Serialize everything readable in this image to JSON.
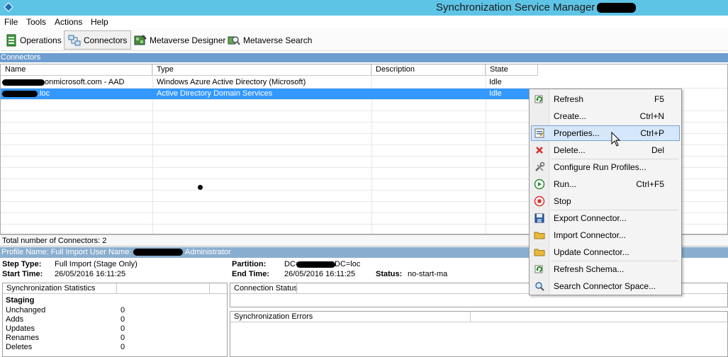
{
  "window": {
    "title": "Synchronization Service Manager on"
  },
  "menu": [
    "File",
    "Tools",
    "Actions",
    "Help"
  ],
  "toolbar": [
    {
      "label": "Operations",
      "icon": "operations-icon"
    },
    {
      "label": "Connectors",
      "icon": "connectors-icon",
      "active": true
    },
    {
      "label": "Metaverse Designer",
      "icon": "metaverse-designer-icon"
    },
    {
      "label": "Metaverse Search",
      "icon": "metaverse-search-icon"
    }
  ],
  "connectors": {
    "section_title": "Connectors",
    "columns": [
      "Name",
      "Type",
      "Description",
      "State"
    ],
    "rows": [
      {
        "name": "onmicrosoft.com - AAD",
        "type": "Windows Azure Active Directory (Microsoft)",
        "description": "",
        "state": "Idle"
      },
      {
        "name": ".loc",
        "type": "Active Directory Domain Services",
        "description": "",
        "state": "Idle",
        "selected": true
      }
    ],
    "total": "Total number of Connectors: 2"
  },
  "profile": {
    "bar_prefix": "Profile Name: Full Import  User Name:",
    "bar_suffix": "Administrator",
    "step_type_label": "Step Type:",
    "step_type": "Full Import (Stage Only)",
    "start_time_label": "Start Time:",
    "start_time": "26/05/2016 16:11:25",
    "partition_label": "Partition:",
    "partition_prefix": "DC=",
    "partition_suffix": "DC=loc",
    "end_time_label": "End Time:",
    "end_time": "26/05/2016 16:11:25",
    "status_label": "Status:",
    "status": "no-start-ma"
  },
  "sync_stats": {
    "title": "Synchronization Statistics",
    "group": "Staging",
    "rows": [
      {
        "label": "Unchanged",
        "value": "0"
      },
      {
        "label": "Adds",
        "value": "0"
      },
      {
        "label": "Updates",
        "value": "0"
      },
      {
        "label": "Renames",
        "value": "0"
      },
      {
        "label": "Deletes",
        "value": "0"
      }
    ]
  },
  "connection_status": {
    "title": "Connection Status"
  },
  "sync_errors": {
    "title": "Synchronization Errors"
  },
  "context_menu": {
    "items": [
      {
        "label": "Refresh",
        "shortcut": "F5",
        "icon": "refresh-icon"
      },
      {
        "label": "Create...",
        "shortcut": "Ctrl+N",
        "icon": "none"
      },
      {
        "label": "Properties...",
        "shortcut": "Ctrl+P",
        "icon": "properties-icon",
        "highlighted": true
      },
      {
        "label": "Delete...",
        "shortcut": "Del",
        "icon": "delete-icon"
      },
      {
        "label": "Configure Run Profiles...",
        "shortcut": "",
        "icon": "tools-icon"
      },
      {
        "label": "Run...",
        "shortcut": "Ctrl+F5",
        "icon": "run-icon"
      },
      {
        "label": "Stop",
        "shortcut": "",
        "icon": "stop-icon"
      },
      {
        "label": "Export Connector...",
        "shortcut": "",
        "icon": "save-icon"
      },
      {
        "label": "Import Connector...",
        "shortcut": "",
        "icon": "folder-icon"
      },
      {
        "label": "Update Connector...",
        "shortcut": "",
        "icon": "folder-icon"
      },
      {
        "label": "Refresh Schema...",
        "shortcut": "",
        "icon": "refresh-icon"
      },
      {
        "label": "Search Connector Space...",
        "shortcut": "",
        "icon": "search-icon"
      }
    ]
  },
  "colors": {
    "titlebar": "#5ec4e6",
    "section_bar": "#6e9ecf",
    "selection": "#3399ff",
    "menu_highlight": "#d5e7fb"
  }
}
